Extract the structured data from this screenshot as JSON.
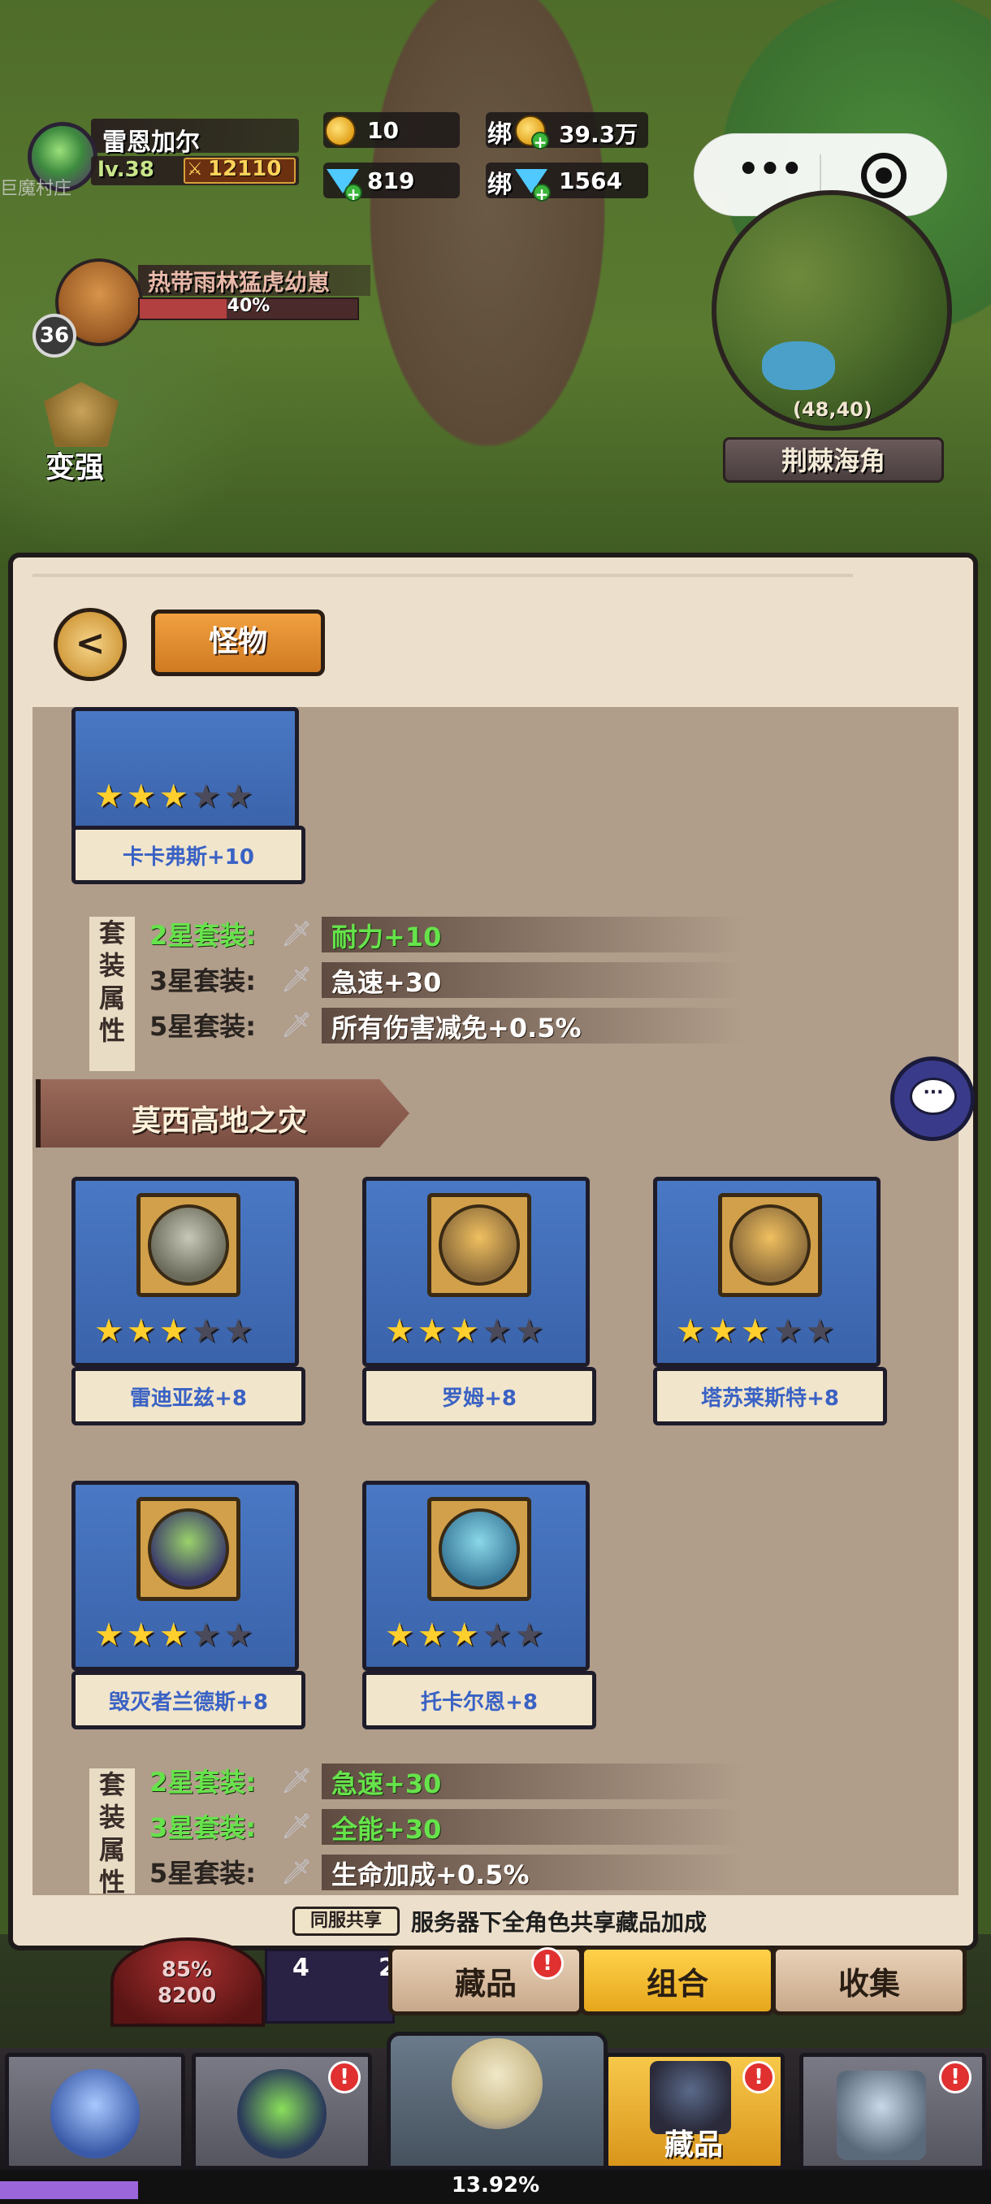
{
  "player": {
    "name": "雷恩加尔",
    "level": "lv.38",
    "power": "12110",
    "faded_label": "巨魔村庄"
  },
  "resources": {
    "gold": "10",
    "gems": "819",
    "bind_label": "绑",
    "bound_gold": "39.3万",
    "bound_gems": "1564"
  },
  "target": {
    "name": "热带雨林猛虎幼崽",
    "level": "36",
    "hp_text": "40%",
    "hp_fraction": 0.4
  },
  "stronger_label": "变强",
  "minimap": {
    "coords": "(48,40)",
    "area_name": "荆棘海角"
  },
  "capsule": {
    "more_icon": "more-dots-icon",
    "close_icon": "target-circle-icon"
  },
  "panel": {
    "tab_label": "怪物",
    "back_icon": "back-arrow-icon"
  },
  "previous_set": {
    "card": {
      "name": "卡卡弗斯",
      "bonus": "+10",
      "stars": 3
    },
    "title_chars": [
      "套",
      "装",
      "属",
      "性"
    ],
    "bonuses": [
      {
        "rank": "2星套装:",
        "value": "耐力+10",
        "active": true
      },
      {
        "rank": "3星套装:",
        "value": "急速+30",
        "active": false
      },
      {
        "rank": "5星套装:",
        "value": "所有伤害减免+0.5%",
        "active": false
      }
    ]
  },
  "section": {
    "title": "莫西高地之灾",
    "cards": [
      {
        "name": "雷迪亚兹",
        "bonus": "+8",
        "stars": 3
      },
      {
        "name": "罗姆",
        "bonus": "+8",
        "stars": 3
      },
      {
        "name": "塔苏莱斯特",
        "bonus": "+8",
        "stars": 3
      },
      {
        "name": "毁灭者兰德斯",
        "bonus": "+8",
        "stars": 3
      },
      {
        "name": "托卡尔恩",
        "bonus": "+8",
        "stars": 3
      }
    ],
    "title_chars": [
      "套",
      "装",
      "属",
      "性"
    ],
    "bonuses": [
      {
        "rank": "2星套装:",
        "value": "急速+30",
        "active": true
      },
      {
        "rank": "3星套装:",
        "value": "全能+30",
        "active": true
      },
      {
        "rank": "5星套装:",
        "value": "生命加成+0.5%",
        "active": false
      }
    ]
  },
  "shared": {
    "badge": "同服共享",
    "text": "服务器下全角色共享藏品加成"
  },
  "sub_tabs": [
    {
      "label": "藏品",
      "badge": "!"
    },
    {
      "label": "组合",
      "badge": ""
    },
    {
      "label": "收集",
      "badge": ""
    }
  ],
  "hud_bottom": {
    "hp_percent": "85%",
    "hp_value": "8200",
    "skill_a": "4",
    "skill_b": "2"
  },
  "bottom_nav": [
    {
      "label": "",
      "icon": "crystal-rock-icon",
      "badge": ""
    },
    {
      "label": "",
      "icon": "hooded-hero-icon",
      "badge": "!"
    },
    {
      "label": "",
      "icon": "skull-crossed-swords-icon",
      "badge": ""
    },
    {
      "label": "藏品",
      "icon": "collection-book-icon",
      "badge": "!"
    },
    {
      "label": "",
      "icon": "castle-icon",
      "badge": "!"
    }
  ],
  "xp": {
    "text": "13.92%",
    "fraction": 0.1392
  },
  "colors": {
    "active_bonus": "#66e34b",
    "inactive_bonus": "#ffffff",
    "star_on": "#ffcf2e",
    "star_off": "#4a4a5a",
    "card_blue": "#4a78c4",
    "card_name": "#3a62c4"
  }
}
